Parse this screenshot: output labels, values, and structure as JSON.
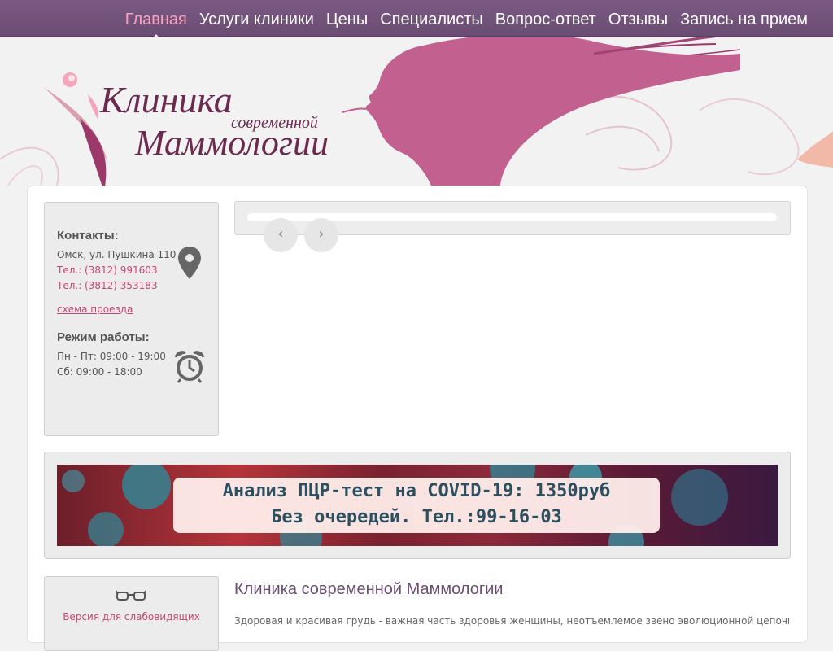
{
  "nav": {
    "items": [
      {
        "label": "Главная",
        "active": true
      },
      {
        "label": "Услуги клиники",
        "active": false
      },
      {
        "label": "Цены",
        "active": false
      },
      {
        "label": "Специалисты",
        "active": false
      },
      {
        "label": "Вопрос-ответ",
        "active": false
      },
      {
        "label": "Отзывы",
        "active": false
      },
      {
        "label": "Запись на прием",
        "active": false
      }
    ]
  },
  "logo": {
    "line1": "Клиника",
    "line2": "современной",
    "line3": "Маммологии"
  },
  "contacts": {
    "heading": "Контакты:",
    "address": "Омск, ул. Пушкина 110",
    "phone1": "Тел.: (3812) 991603",
    "phone2": "Тел.: (3812) 353183",
    "map_link": "схема проезда",
    "hours_heading": "Режим работы:",
    "hours_weekdays": "Пн - Пт: 09:00 - 19:00",
    "hours_saturday": "Сб: 09:00 - 18:00"
  },
  "slider": {
    "prev": "‹",
    "next": "›"
  },
  "promo": {
    "line1": "Анализ ПЦР-тест на COVID-19: 1350руб",
    "line2": "Без очередей. Тел.:99-16-03"
  },
  "accessibility": {
    "label": "Версия для слабовидящих"
  },
  "content": {
    "title": "Клиника современной Маммологии",
    "intro": "Здоровая и красивая грудь - важная часть здоровья женщины, неотъемлемое звено эволюционной цепочки,"
  },
  "colors": {
    "nav_bg": "#6b4c72",
    "accent_pink": "#c8456f",
    "logo_text": "#6b2a4e",
    "title_purple": "#6b4c72"
  }
}
